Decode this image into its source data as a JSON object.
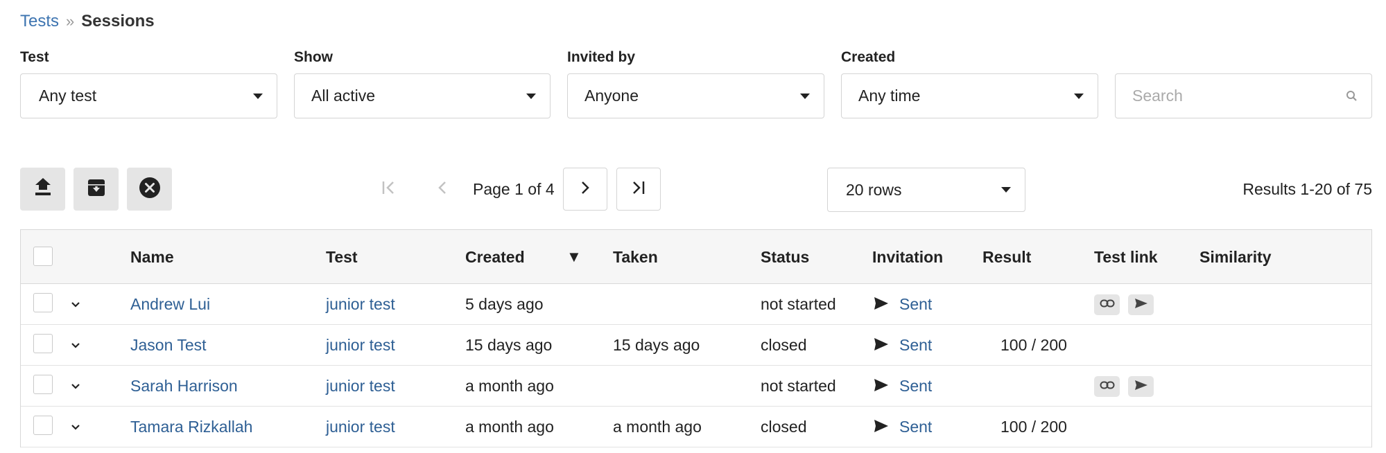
{
  "breadcrumb": {
    "parent": "Tests",
    "separator": "»",
    "current": "Sessions"
  },
  "filters": {
    "test": {
      "label": "Test",
      "value": "Any test"
    },
    "show": {
      "label": "Show",
      "value": "All active"
    },
    "invited_by": {
      "label": "Invited by",
      "value": "Anyone"
    },
    "created": {
      "label": "Created",
      "value": "Any time"
    },
    "search": {
      "placeholder": "Search",
      "value": ""
    }
  },
  "toolbar": {
    "icons": [
      "upload-icon",
      "archive-icon",
      "close-circle-icon"
    ],
    "page_text": "Page 1 of 4",
    "rows_value": "20 rows",
    "results": "Results 1-20 of 75"
  },
  "table": {
    "columns": {
      "name": "Name",
      "test": "Test",
      "created": "Created",
      "sort_indicator": "▼",
      "taken": "Taken",
      "status": "Status",
      "invitation": "Invitation",
      "result": "Result",
      "test_link": "Test link",
      "similarity": "Similarity"
    },
    "rows": [
      {
        "name": "Andrew Lui",
        "test": "junior test",
        "created": "5 days ago",
        "taken": "",
        "status": "not started",
        "invitation": "Sent",
        "result": "",
        "has_link_actions": true
      },
      {
        "name": "Jason Test",
        "test": "junior test",
        "created": "15 days ago",
        "taken": "15 days ago",
        "status": "closed",
        "invitation": "Sent",
        "result": "100 / 200",
        "has_link_actions": false
      },
      {
        "name": "Sarah Harrison",
        "test": "junior test",
        "created": "a month ago",
        "taken": "",
        "status": "not started",
        "invitation": "Sent",
        "result": "",
        "has_link_actions": true
      },
      {
        "name": "Tamara Rizkallah",
        "test": "junior test",
        "created": "a month ago",
        "taken": "a month ago",
        "status": "closed",
        "invitation": "Sent",
        "result": "100 / 200",
        "has_link_actions": false
      }
    ]
  },
  "colors": {
    "link": "#2e5f94",
    "breadcrumb_link": "#3d74b0",
    "button_bg": "#e5e5e5",
    "header_bg": "#f6f6f6"
  }
}
